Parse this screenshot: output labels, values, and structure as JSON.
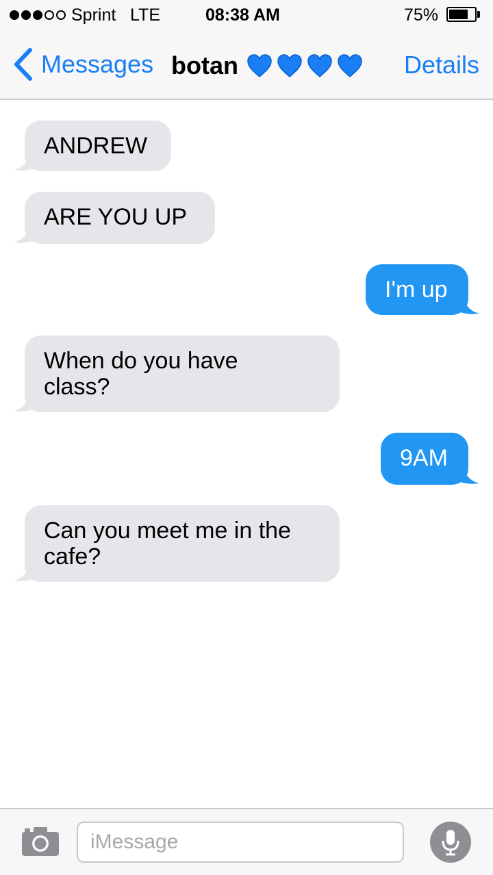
{
  "status_bar": {
    "signal_dots": [
      1,
      1,
      1,
      0,
      0
    ],
    "carrier": "Sprint",
    "network": "LTE",
    "time": "08:38 AM",
    "battery_percent_text": "75%",
    "battery_level": 0.75
  },
  "nav": {
    "back_label": "Messages",
    "contact_name": "botan",
    "contact_emoji": [
      "blue-heart",
      "blue-heart",
      "blue-heart",
      "blue-heart"
    ],
    "details_label": "Details"
  },
  "messages": [
    {
      "direction": "incoming",
      "text": "ANDREW"
    },
    {
      "direction": "incoming",
      "text": "ARE YOU UP"
    },
    {
      "direction": "outgoing",
      "text": "I'm up"
    },
    {
      "direction": "incoming",
      "text": "When do you have\nclass?"
    },
    {
      "direction": "outgoing",
      "text": "9AM"
    },
    {
      "direction": "incoming",
      "text": "Can you meet me in the\ncafe?"
    }
  ],
  "input_bar": {
    "placeholder": "iMessage",
    "value": "",
    "camera_icon": "camera-icon",
    "mic_icon": "microphone-icon"
  },
  "colors": {
    "accent": "#1a7ef5",
    "outgoing_bubble": "#2196f3",
    "incoming_bubble": "#e5e5ea",
    "bar_background": "#f7f7f8"
  }
}
